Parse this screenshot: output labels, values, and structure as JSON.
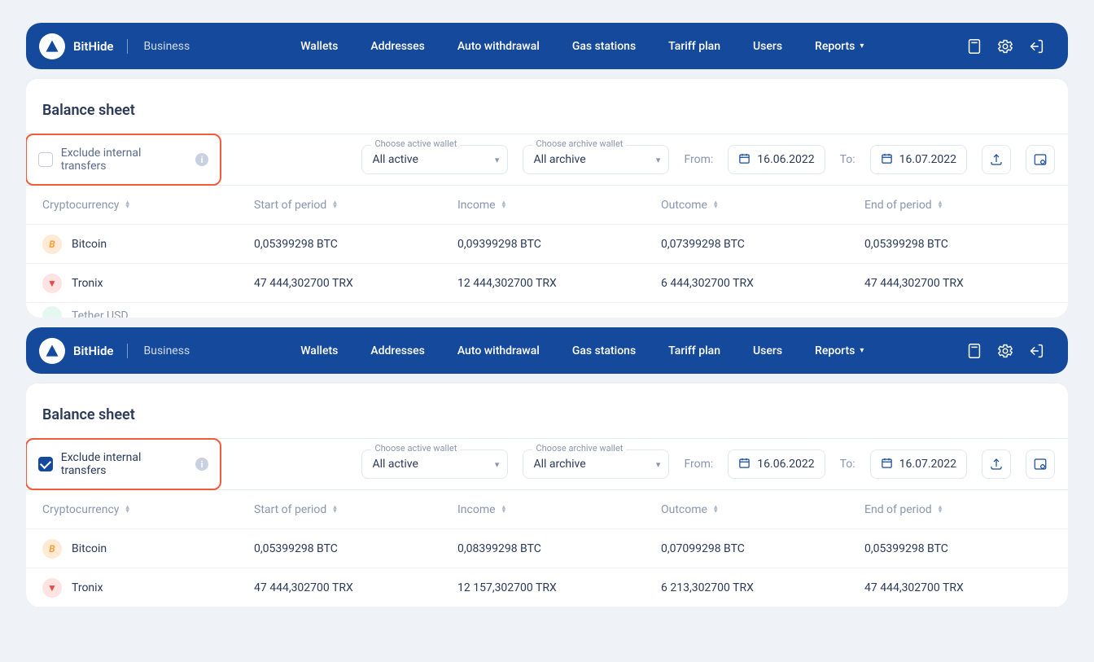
{
  "brand": {
    "name": "BitHide",
    "sub": "Business"
  },
  "nav": {
    "wallets": "Wallets",
    "addresses": "Addresses",
    "autowd": "Auto withdrawal",
    "gas": "Gas stations",
    "tariff": "Tariff plan",
    "users": "Users",
    "reports": "Reports"
  },
  "page_title": "Balance sheet",
  "filters": {
    "exclude_label": "Exclude internal transfers",
    "active_label": "Choose active wallet",
    "active_value": "All active",
    "archive_label": "Choose archive wallet",
    "archive_value": "All archive",
    "from_label": "From:",
    "from_value": "16.06.2022",
    "to_label": "To:",
    "to_value": "16.07.2022"
  },
  "cols": {
    "c1": "Cryptocurrency",
    "c2": "Start of period",
    "c3": "Income",
    "c4": "Outcome",
    "c5": "End of period"
  },
  "panel1": {
    "rows": [
      {
        "name": "Bitcoin",
        "icon": "btc",
        "glyph": "B",
        "start": "0,05399298 BTC",
        "income": "0,09399298 BTC",
        "outcome": "0,07399298 BTC",
        "end": "0,05399298 BTC"
      },
      {
        "name": "Tronix",
        "icon": "trx",
        "glyph": "▼",
        "start": "47 444,302700 TRX",
        "income": "12 444,302700 TRX",
        "outcome": "6 444,302700 TRX",
        "end": "47 444,302700 TRX"
      }
    ],
    "partial": "Tether USD"
  },
  "panel2": {
    "rows": [
      {
        "name": "Bitcoin",
        "icon": "btc",
        "glyph": "B",
        "start": "0,05399298 BTC",
        "income": "0,08399298 BTC",
        "outcome": "0,07099298 BTC",
        "end": "0,05399298 BTC"
      },
      {
        "name": "Tronix",
        "icon": "trx",
        "glyph": "▼",
        "start": "47 444,302700 TRX",
        "income": "12 157,302700 TRX",
        "outcome": "6 213,302700 TRX",
        "end": "47 444,302700 TRX"
      }
    ]
  }
}
